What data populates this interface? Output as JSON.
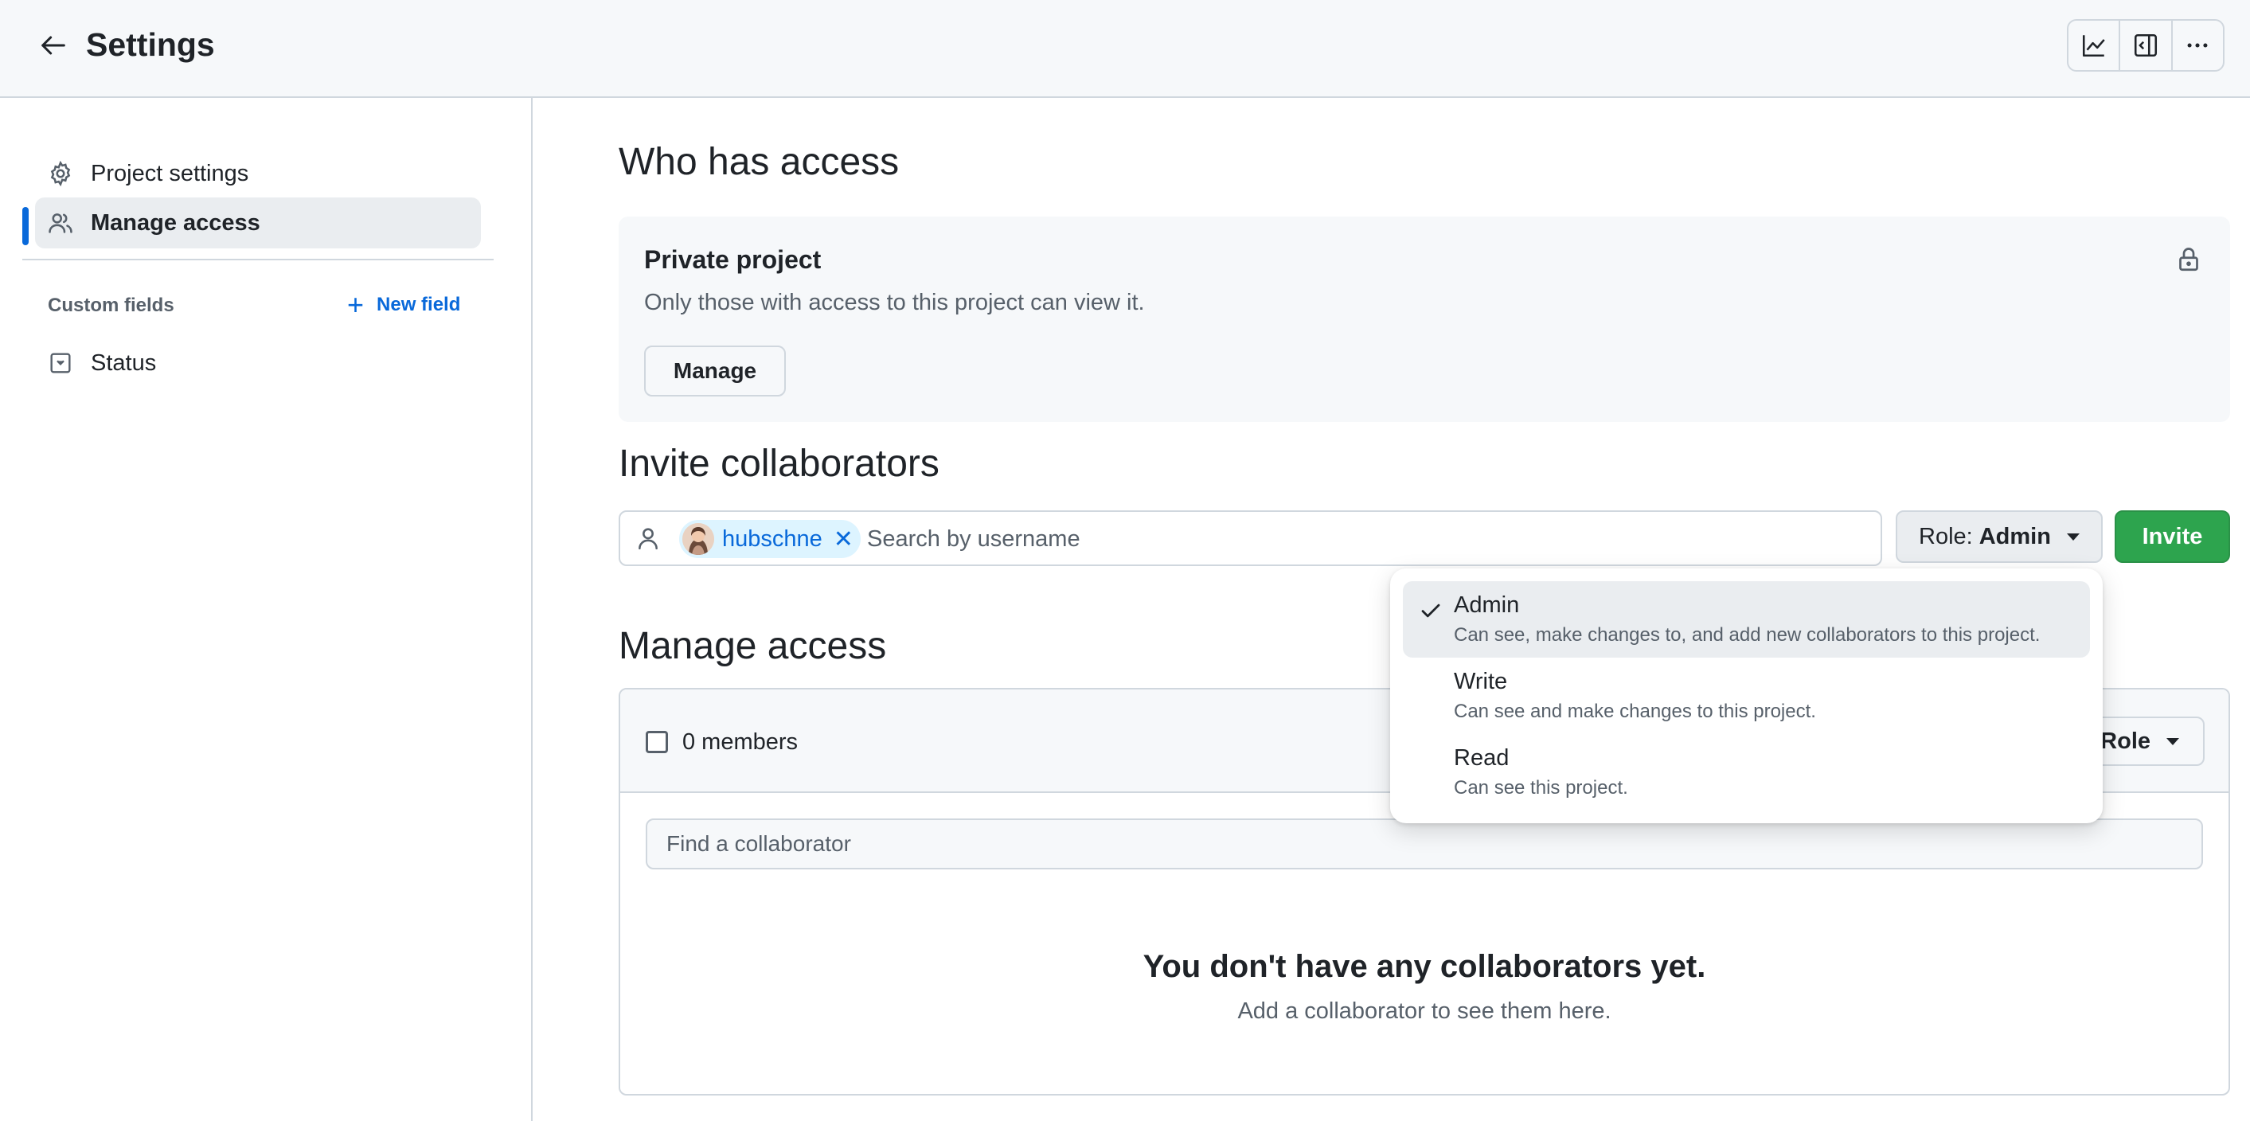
{
  "header": {
    "title": "Settings",
    "tools": [
      "insights-icon",
      "sidebar-icon",
      "more-icon"
    ]
  },
  "sidebar": {
    "items": [
      {
        "label": "Project settings",
        "icon": "gear-icon"
      },
      {
        "label": "Manage access",
        "icon": "people-icon",
        "active": true
      }
    ],
    "custom_fields_label": "Custom fields",
    "new_field_label": "New field",
    "fields": [
      {
        "label": "Status",
        "icon": "single-select-icon"
      }
    ]
  },
  "who_has_access": {
    "title": "Who has access",
    "private_title": "Private project",
    "private_desc": "Only those with access to this project can view it.",
    "manage_label": "Manage"
  },
  "invite": {
    "title": "Invite collaborators",
    "chip_user": "hubschne",
    "search_placeholder": "Search by username",
    "role_prefix": "Role:",
    "role_value": "Admin",
    "invite_label": "Invite"
  },
  "manage_access": {
    "title": "Manage access",
    "members_count": "0 members",
    "role_filter_label": "Role",
    "find_placeholder": "Find a collaborator",
    "empty_title": "You don't have any collaborators yet.",
    "empty_sub": "Add a collaborator to see them here."
  },
  "role_menu": {
    "options": [
      {
        "title": "Admin",
        "desc": "Can see, make changes to, and add new collaborators to this project.",
        "selected": true
      },
      {
        "title": "Write",
        "desc": "Can see and make changes to this project."
      },
      {
        "title": "Read",
        "desc": "Can see this project."
      }
    ]
  },
  "colors": {
    "accent": "#0969da",
    "invite_green": "#2da44e",
    "border": "#d0d7de",
    "muted_text": "#57606a"
  }
}
